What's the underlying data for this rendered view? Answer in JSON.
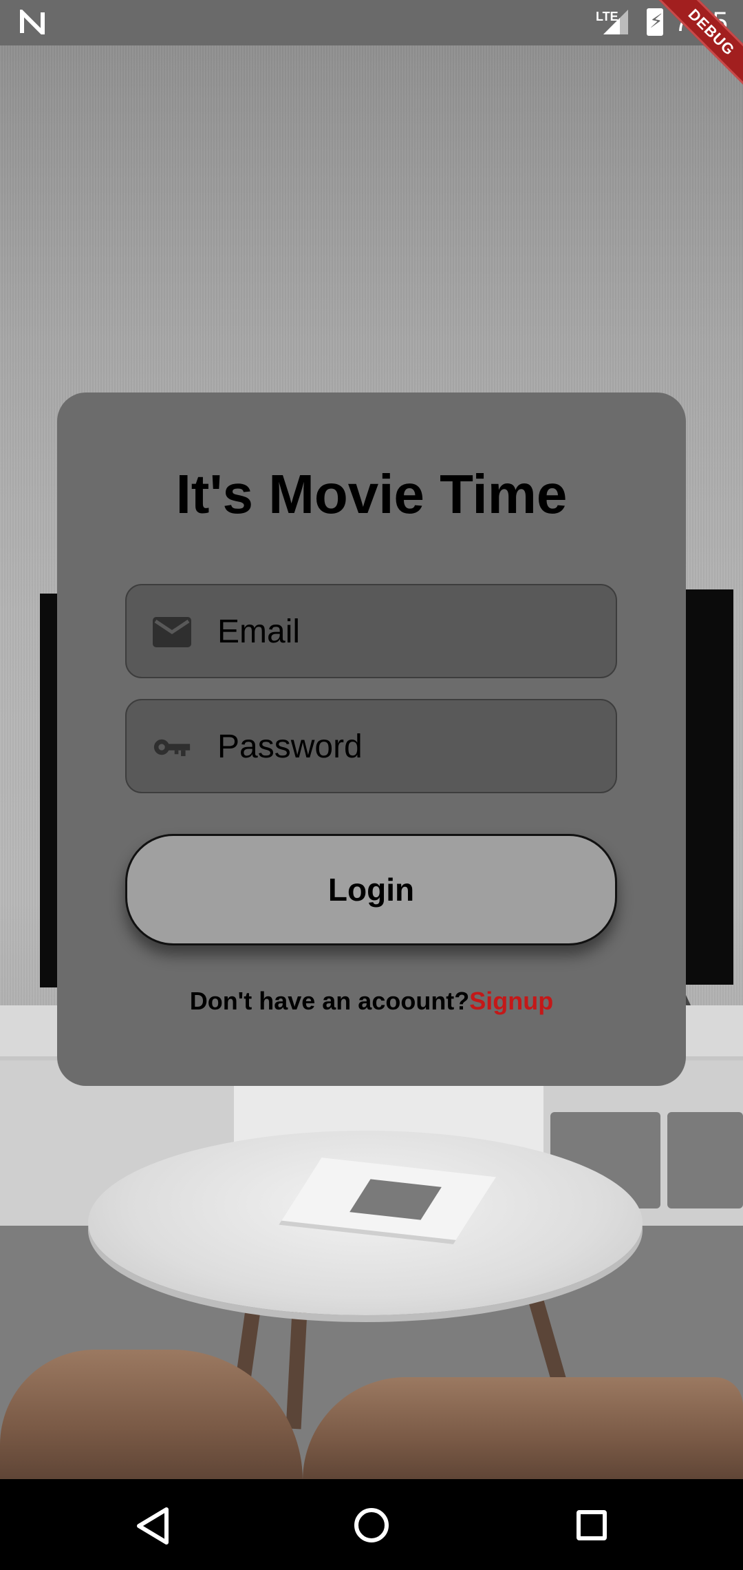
{
  "status_bar": {
    "time": "7:05",
    "network": "LTE",
    "debug_banner": "DEBUG",
    "icons": [
      "notification-n-icon",
      "signal-icon",
      "battery-charging-icon"
    ]
  },
  "login_card": {
    "title": "It's Movie Time",
    "email_field": {
      "placeholder": "Email",
      "icon": "email-icon"
    },
    "password_field": {
      "placeholder": "Password",
      "icon": "key-icon"
    },
    "login_button": "Login",
    "signup_prompt": "Don't have an acoount?",
    "signup_link": "Signup"
  },
  "colors": {
    "card": "#6c6c6c",
    "field": "#595959",
    "button": "#a0a0a0",
    "signup_link": "#c41818",
    "debug_banner": "#a21f1f"
  },
  "navigation_bar": {
    "icons": [
      "back-icon",
      "home-icon",
      "recents-icon"
    ]
  }
}
